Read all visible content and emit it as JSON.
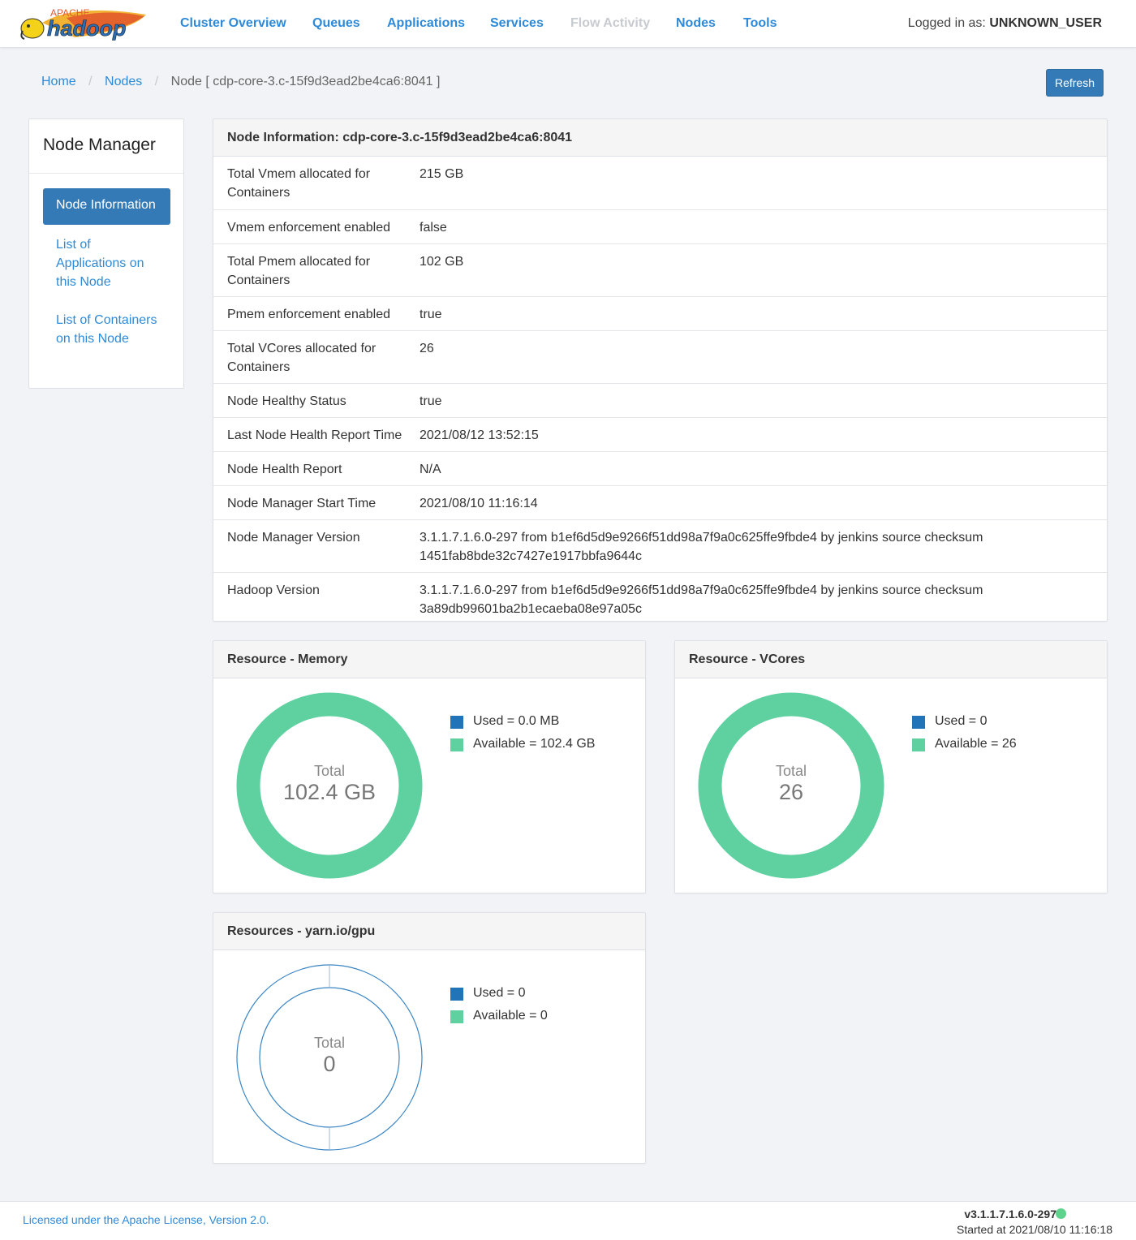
{
  "nav": {
    "logo_text": "hadoop",
    "logo_apache": "APACHE",
    "items": [
      "Cluster Overview",
      "Queues",
      "Applications",
      "Services",
      "Flow Activity",
      "Nodes",
      "Tools"
    ],
    "disabled_item": "Flow Activity",
    "logged_in_label": "Logged in as:",
    "logged_in_user": "UNKNOWN_USER"
  },
  "breadcrumb": {
    "home": "Home",
    "nodes": "Nodes",
    "current": "Node [ cdp-core-3.c-15f9d3ead2be4ca6:8041 ]",
    "separator": "/"
  },
  "refresh_label": "Refresh",
  "sidebar": {
    "title": "Node Manager",
    "active": "Node Information",
    "links": [
      "List of Applications on this Node",
      "List of Containers on this Node"
    ]
  },
  "node_info": {
    "title": "Node Information: cdp-core-3.c-15f9d3ead2be4ca6:8041",
    "rows": [
      {
        "key": "Total Vmem allocated for Containers",
        "value": "215 GB"
      },
      {
        "key": "Vmem enforcement enabled",
        "value": "false"
      },
      {
        "key": "Total Pmem allocated for Containers",
        "value": "102 GB"
      },
      {
        "key": "Pmem enforcement enabled",
        "value": "true"
      },
      {
        "key": "Total VCores allocated for Containers",
        "value": "26"
      },
      {
        "key": "Node Healthy Status",
        "value": "true"
      },
      {
        "key": "Last Node Health Report Time",
        "value": "2021/08/12 13:52:15"
      },
      {
        "key": "Node Health Report",
        "value": "N/A"
      },
      {
        "key": "Node Manager Start Time",
        "value": "2021/08/10 11:16:14"
      },
      {
        "key": "Node Manager Version",
        "value": "3.1.1.7.1.6.0-297 from b1ef6d5d9e9266f51dd98a7f9a0c625ffe9fbde4 by jenkins source checksum 1451fab8bde32c7427e1917bbfa9644c"
      },
      {
        "key": "Hadoop Version",
        "value": "3.1.1.7.1.6.0-297 from b1ef6d5d9e9266f51dd98a7f9a0c625ffe9fbde4 by jenkins source checksum 3a89db99601ba2b1ecaeba08e97a05c"
      }
    ]
  },
  "colors": {
    "used": "#2274b8",
    "available": "#5fd1a0",
    "accent": "#337ab7",
    "link": "#2e8ad8",
    "gpu_outer": "#3a85c4",
    "gpu_inner": "#74d6b1"
  },
  "resources": {
    "memory": {
      "title": "Resource - Memory",
      "total_label": "Total",
      "total_value": "102.4 GB",
      "used_label": "Used = 0.0 MB",
      "available_label": "Available = 102.4 GB",
      "used": 0.0,
      "available": 102.4
    },
    "vcores": {
      "title": "Resource - VCores",
      "total_label": "Total",
      "total_value": "26",
      "used_label": "Used = 0",
      "available_label": "Available = 26",
      "used": 0,
      "available": 26
    },
    "gpu": {
      "title": "Resources - yarn.io/gpu",
      "total_label": "Total",
      "total_value": "0",
      "used_label": "Used = 0",
      "available_label": "Available = 0",
      "used": 0,
      "available": 0
    }
  },
  "footer": {
    "license": "Licensed under the Apache License, Version 2.0.",
    "version": "v3.1.1.7.1.6.0-297",
    "started": "Started at 2021/08/10 11:16:18"
  }
}
